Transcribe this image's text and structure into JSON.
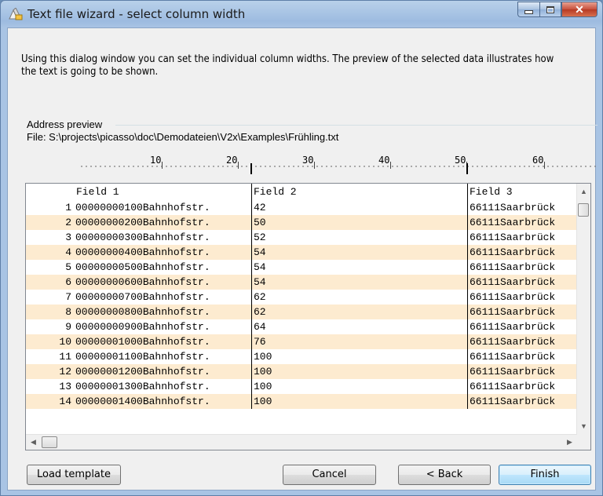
{
  "window": {
    "title": "Text file wizard - select column width",
    "icon": "wizard-icon"
  },
  "description": "Using this dialog window you can set the individual column widths. The preview of the selected data illustrates how the text is going to be shown.",
  "preview": {
    "group_label": "Address preview",
    "file_path": "File: S:\\projects\\picasso\\doc\\Demodateien\\V2x\\Examples\\Frühling.txt"
  },
  "ruler": {
    "labels": [
      "10",
      "20",
      "30",
      "40",
      "50",
      "60"
    ]
  },
  "grid": {
    "columns": [
      "Field 1",
      "Field 2",
      "Field 3"
    ],
    "rows": [
      {
        "n": "1",
        "f1": "00000000100Bahnhofstr.",
        "f2": "42",
        "f3": "66111Saarbrück"
      },
      {
        "n": "2",
        "f1": "00000000200Bahnhofstr.",
        "f2": "50",
        "f3": "66111Saarbrück"
      },
      {
        "n": "3",
        "f1": "00000000300Bahnhofstr.",
        "f2": "52",
        "f3": "66111Saarbrück"
      },
      {
        "n": "4",
        "f1": "00000000400Bahnhofstr.",
        "f2": "54",
        "f3": "66111Saarbrück"
      },
      {
        "n": "5",
        "f1": "00000000500Bahnhofstr.",
        "f2": "54",
        "f3": "66111Saarbrück"
      },
      {
        "n": "6",
        "f1": "00000000600Bahnhofstr.",
        "f2": "54",
        "f3": "66111Saarbrück"
      },
      {
        "n": "7",
        "f1": "00000000700Bahnhofstr.",
        "f2": "62",
        "f3": "66111Saarbrück"
      },
      {
        "n": "8",
        "f1": "00000000800Bahnhofstr.",
        "f2": "62",
        "f3": "66111Saarbrück"
      },
      {
        "n": "9",
        "f1": "00000000900Bahnhofstr.",
        "f2": "64",
        "f3": "66111Saarbrück"
      },
      {
        "n": "10",
        "f1": "00000001000Bahnhofstr.",
        "f2": "76",
        "f3": "66111Saarbrück"
      },
      {
        "n": "11",
        "f1": "00000001100Bahnhofstr.",
        "f2": "100",
        "f3": "66111Saarbrück"
      },
      {
        "n": "12",
        "f1": "00000001200Bahnhofstr.",
        "f2": "100",
        "f3": "66111Saarbrück"
      },
      {
        "n": "13",
        "f1": "00000001300Bahnhofstr.",
        "f2": "100",
        "f3": "66111Saarbrück"
      },
      {
        "n": "14",
        "f1": "00000001400Bahnhofstr.",
        "f2": "100",
        "f3": "66111Saarbrück"
      }
    ]
  },
  "buttons": {
    "load_template": "Load template",
    "cancel": "Cancel",
    "back": "< Back",
    "finish": "Finish"
  },
  "colors": {
    "alt_row": "#fdebd0",
    "title_bar": "#b9d1ea",
    "close_button": "#c7503c"
  }
}
